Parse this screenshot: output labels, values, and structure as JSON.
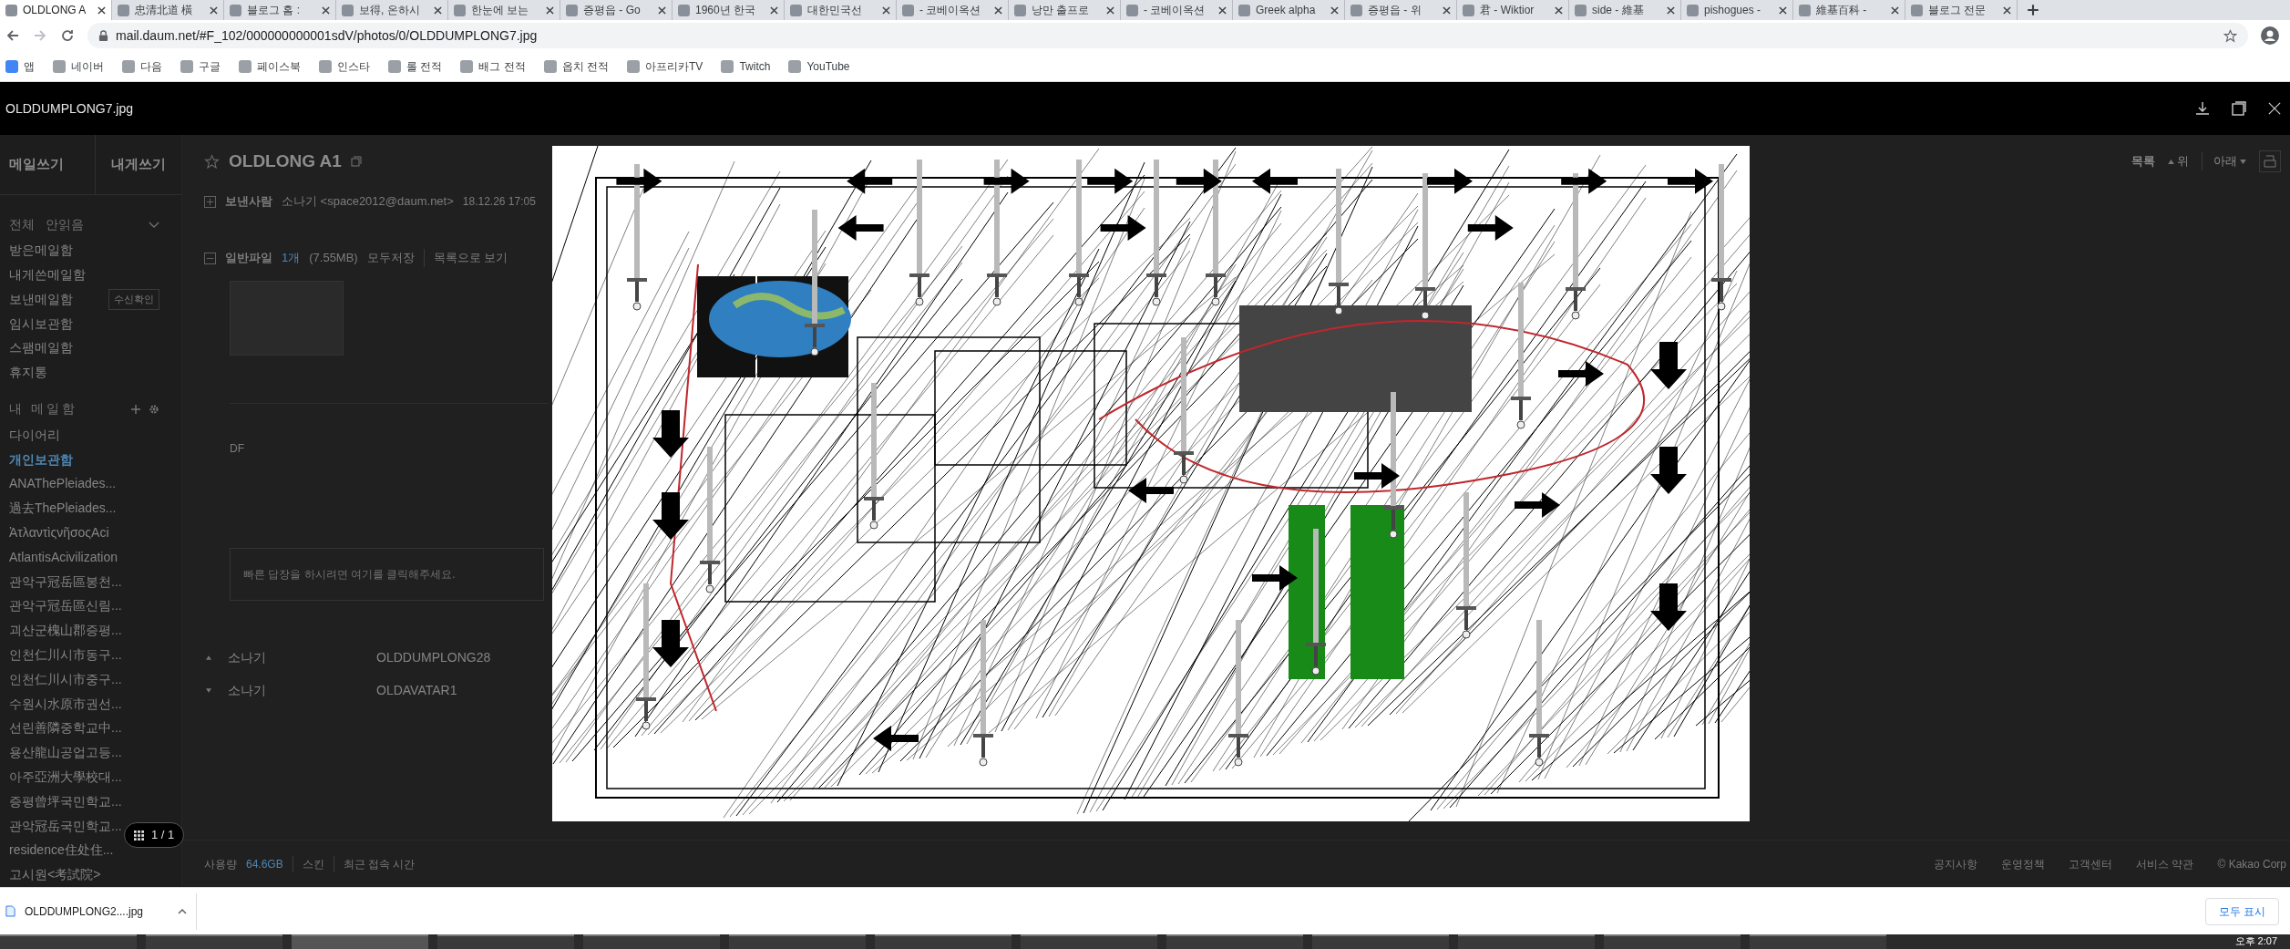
{
  "browser": {
    "tabs": [
      {
        "title": "OLDLONG A",
        "selected": true
      },
      {
        "title": "忠清北道 橫",
        "selected": false
      },
      {
        "title": "블로그 홈 :",
        "selected": false
      },
      {
        "title": "보得, 온하시",
        "selected": false
      },
      {
        "title": "한눈에 보는",
        "selected": false
      },
      {
        "title": "증평읍 - Go",
        "selected": false
      },
      {
        "title": "1960년 한국",
        "selected": false
      },
      {
        "title": "대한민국선",
        "selected": false
      },
      {
        "title": "- 코베이옥션",
        "selected": false
      },
      {
        "title": "낭만 출프로",
        "selected": false
      },
      {
        "title": "- 코베이옥션",
        "selected": false
      },
      {
        "title": "Greek alpha",
        "selected": false
      },
      {
        "title": "증평읍 - 위",
        "selected": false
      },
      {
        "title": "君 - Wiktior",
        "selected": false
      },
      {
        "title": "side - 維基",
        "selected": false
      },
      {
        "title": "pishogues -",
        "selected": false
      },
      {
        "title": "維基百科 -",
        "selected": false
      },
      {
        "title": "블로그 전문",
        "selected": false
      }
    ],
    "address": "mail.daum.net/#F_102/000000000001sdV/photos/0/OLDDUMPLONG7.jpg",
    "bookmarks": [
      "앱",
      "네이버",
      "다음",
      "구글",
      "페이스북",
      "인스타",
      "롤 전적",
      "배그 전적",
      "옵치 전적",
      "아프리카TV",
      "Twitch",
      "YouTube"
    ]
  },
  "viewer": {
    "filename": "OLDDUMPLONG7.jpg",
    "counter": "1 / 1"
  },
  "mail": {
    "compose": "메일쓰기",
    "self_compose": "내게쓰기",
    "filters": [
      "전체",
      "안읽음"
    ],
    "folders": [
      {
        "label": "받은메일함"
      },
      {
        "label": "내게쓴메일함"
      },
      {
        "label": "보낸메일함",
        "badge": "수신확인"
      },
      {
        "label": "임시보관함"
      },
      {
        "label": "스팸메일함"
      },
      {
        "label": "휴지통"
      }
    ],
    "my_mailbox": "내 메일함",
    "custom_folders": [
      {
        "label": "다이어리",
        "selected": false
      },
      {
        "label": "개인보관함",
        "selected": true
      },
      {
        "label": "ANAThePleiades...",
        "selected": false
      },
      {
        "label": "過去ThePleiades...",
        "selected": false
      },
      {
        "label": "ἈτλαντὶςνῆσοςAci",
        "selected": false
      },
      {
        "label": "AtlantisAcivilization",
        "selected": false
      },
      {
        "label": "관악구冠岳區봉천...",
        "selected": false
      },
      {
        "label": "관악구冠岳區신림...",
        "selected": false
      },
      {
        "label": "괴산군槐山郡증평...",
        "selected": false
      },
      {
        "label": "인천仁川시市동구...",
        "selected": false
      },
      {
        "label": "인천仁川시市중구...",
        "selected": false
      },
      {
        "label": "수원시水原市권선...",
        "selected": false
      },
      {
        "label": "선린善隣중학교中...",
        "selected": false
      },
      {
        "label": "용산龍山공업고등...",
        "selected": false
      },
      {
        "label": "아주亞洲大學校대...",
        "selected": false
      },
      {
        "label": "증평曾坪국민학교...",
        "selected": false
      },
      {
        "label": "관악冠岳국민학교...",
        "selected": false
      },
      {
        "label": "residence住处住...",
        "selected": false
      },
      {
        "label": "고시원<考試院>",
        "selected": false
      }
    ],
    "subject": "OLDLONG A1",
    "sender_label": "보낸사람",
    "sender": "소나기 <space2012@daum.net>",
    "date": "18.12.26 17:05",
    "attachment": {
      "label": "일반파일",
      "count": "1개",
      "size": "(7.55MB)",
      "save_all": "모두저장",
      "list_view": "목록으로 보기"
    },
    "body": "DF",
    "reply_placeholder": "빠른 답장을 하시려면 여기를 클릭해주세요.",
    "thread": [
      {
        "kind": "prev",
        "from": "소나기",
        "subject": "OLDDUMPLONG28"
      },
      {
        "kind": "next",
        "from": "소나기",
        "subject": "OLDAVATAR1"
      }
    ],
    "toolbar": {
      "list": "목록",
      "up": "위",
      "down": "아래"
    },
    "footer_left": {
      "usage_label": "사용량",
      "usage": "64.6GB",
      "skin": "스킨",
      "last_access": "최근 접속 시간"
    },
    "footer_right": [
      "공지사항",
      "운영정책",
      "고객센터",
      "서비스 약관",
      "© Kakao Corp"
    ]
  },
  "downloads": {
    "file": "OLDDUMPLONG2....jpg",
    "show_all": "모두 표시"
  },
  "taskbar": {
    "clock": "오후 2:07"
  }
}
